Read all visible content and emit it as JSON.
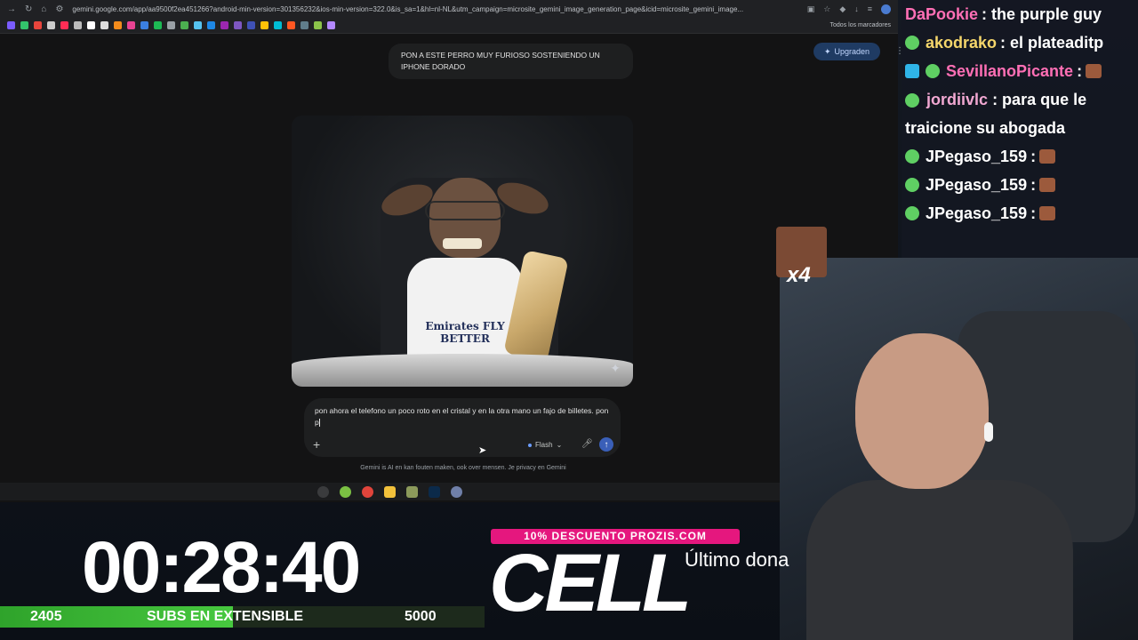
{
  "browser": {
    "url": "gemini.google.com/app/aa9500f2ea451266?android-min-version=301356232&ios-min-version=322.0&is_sa=1&hl=nl-NL&utm_campaign=microsite_gemini_image_generation_page&icid=microsite_gemini_image...",
    "bookmarks_all": "Todos los marcadores"
  },
  "gemini": {
    "user_message": "PON A ESTE PERRO MUY FURIOSO SOSTENIENDO UN IPHONE DORADO",
    "upgrade_label": "Upgraden",
    "shirt_text": "Emirates FLY BETTER",
    "prompt_text": "pon ahora el telefono un poco roto en el cristal y en la otra mano un fajo de billetes. pon p",
    "model_label": "Flash",
    "disclaimer": "Gemini is AI en kan fouten maken, ook over mensen. Je privacy en Gemini"
  },
  "chat": {
    "messages": [
      {
        "user": "DaPookie",
        "text": ": the purple guy"
      },
      {
        "user": "akodrako",
        "text": ": el plateaditp"
      },
      {
        "user": "SevillanoPicante",
        "text": ":"
      },
      {
        "user": "jordiivlc",
        "text": ": para que le traicione su abogada"
      },
      {
        "user": "JPegaso_159",
        "text": ":"
      },
      {
        "user": "JPegaso_159",
        "text": ":"
      },
      {
        "user": "JPegaso_159",
        "text": ":"
      }
    ]
  },
  "overlay": {
    "emote_multiplier": "x4",
    "timer": "00:28:40",
    "subs_current": "2405",
    "subs_label": "SUBS EN EXTENSIBLE",
    "subs_goal": "5000",
    "subs_progress": 0.481,
    "promo": "10% DESCUENTO PROZIS.COM",
    "brand": "CELL",
    "last_donation": "Último dona"
  },
  "colors": {
    "progress_green": "#47c83f",
    "promo_pink": "#e5177e",
    "gemini_blue": "#1f3b63"
  }
}
